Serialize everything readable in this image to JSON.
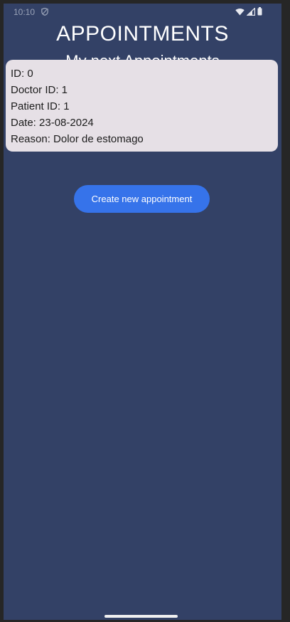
{
  "status_bar": {
    "time": "10:10",
    "icons": [
      "shield-icon",
      "wifi-icon",
      "signal-icon",
      "battery-icon"
    ]
  },
  "header": {
    "title": "APPOINTMENTS",
    "subtitle": "My next Appointments"
  },
  "appointment": {
    "id": "ID: 0",
    "doctor_id": "Doctor ID: 1",
    "patient_id": "Patient ID: 1",
    "date": "Date: 23-08-2024",
    "reason": "Reason: Dolor de estomago"
  },
  "actions": {
    "create_label": "Create new appointment"
  },
  "colors": {
    "background": "#334166",
    "card": "#e6e0e6",
    "button": "#3673ea"
  }
}
